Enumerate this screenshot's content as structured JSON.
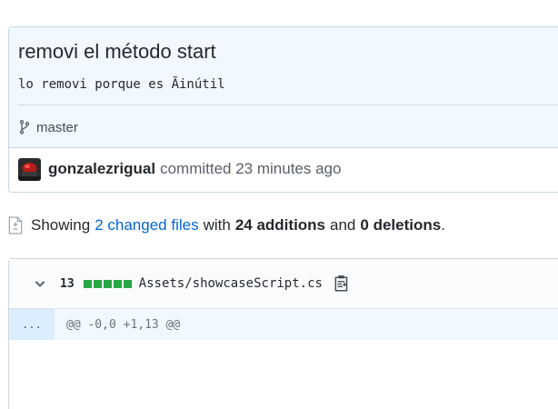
{
  "commit": {
    "title": "removi el método start",
    "description": "lo removi porque es Ãinútil",
    "branch": "master",
    "author": "gonzalezrigual",
    "action": "committed 23 minutes ago"
  },
  "summary": {
    "prefix": "Showing",
    "changed_files": "2 changed files",
    "with": "with",
    "additions": "24 additions",
    "and": "and",
    "deletions": "0 deletions",
    "suffix": "."
  },
  "file": {
    "changes": "13",
    "diffstat_added_blocks": 5,
    "path": "Assets/showcaseScript.cs",
    "hunk_expander": "...",
    "hunk_header": "@@ -0,0 +1,13 @@"
  },
  "colors": {
    "accent_link": "#0366d6",
    "addition_green": "#28a745",
    "commit_header_bg": "#f1f8ff"
  },
  "icons": {
    "branch": "git-branch-icon",
    "diff": "file-diff-icon",
    "chevron": "chevron-down-icon",
    "copy": "clippy-icon"
  }
}
